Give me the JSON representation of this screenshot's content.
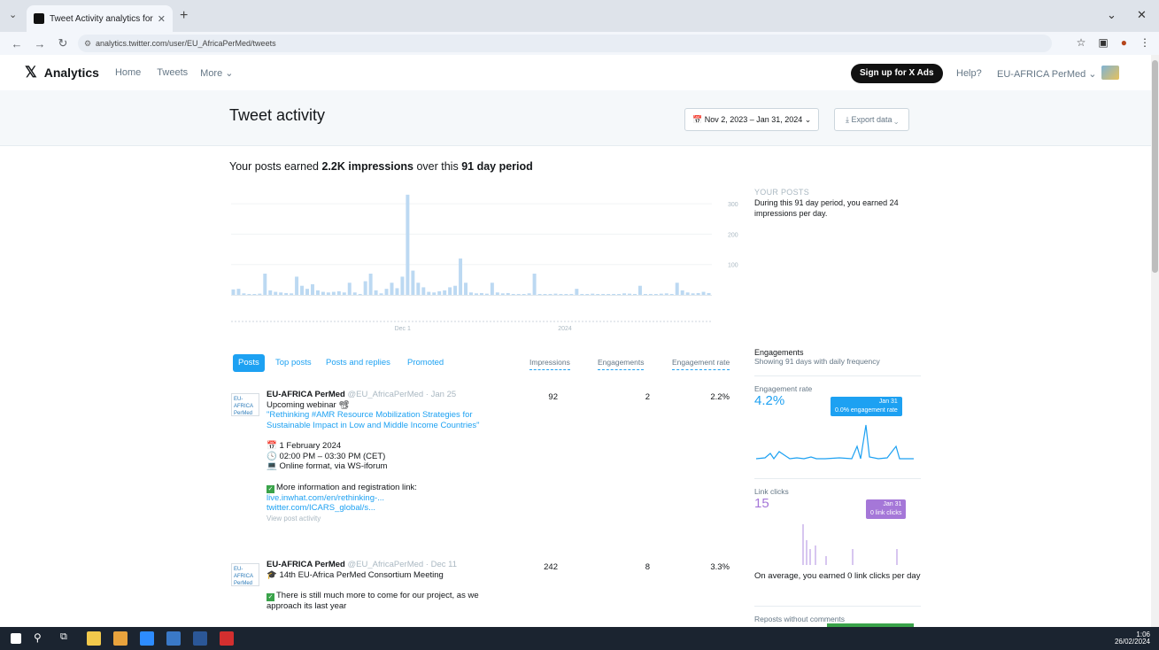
{
  "browser": {
    "tab_title": "Tweet Activity analytics for EU…",
    "url": "analytics.twitter.com/user/EU_AfricaPerMed/tweets"
  },
  "header": {
    "brand": "Analytics",
    "nav": [
      "Home",
      "Tweets",
      "More ⌄"
    ],
    "signup_label": "Sign up for X Ads",
    "help_label": "Help?",
    "account_label": "EU-AFRICA PerMed ⌄"
  },
  "title_band": {
    "title": "Tweet activity",
    "date_range": "📅 Nov 2, 2023 – Jan 31, 2024 ⌄",
    "export_label": "⤓ Export data ⌄"
  },
  "summary": {
    "prefix": "Your posts earned ",
    "highlight": "2.2K impressions",
    "middle": " over this ",
    "period": "91 day period"
  },
  "chart_data": {
    "type": "bar",
    "ylim": [
      0,
      350
    ],
    "yticks": [
      100,
      200,
      300
    ],
    "xtick_labels": [
      "Dec 1",
      "2024"
    ],
    "values": [
      18,
      20,
      5,
      3,
      2,
      4,
      70,
      15,
      10,
      8,
      6,
      5,
      60,
      30,
      20,
      35,
      15,
      10,
      8,
      10,
      12,
      8,
      40,
      8,
      3,
      45,
      70,
      15,
      5,
      20,
      40,
      22,
      60,
      330,
      80,
      40,
      25,
      10,
      8,
      12,
      15,
      25,
      30,
      120,
      40,
      8,
      5,
      6,
      4,
      40,
      8,
      5,
      6,
      3,
      3,
      2,
      5,
      70,
      2,
      2,
      3,
      4,
      2,
      2,
      3,
      20,
      3,
      2,
      4,
      2,
      3,
      2,
      3,
      2,
      5,
      4,
      3,
      30,
      2,
      3,
      2,
      4,
      5,
      3,
      40,
      15,
      8,
      5,
      6,
      10,
      6
    ],
    "highlight_marker": "—"
  },
  "your_posts": {
    "heading": "YOUR POSTS",
    "text": "During this 91 day period, you earned 24 impressions per day."
  },
  "post_tabs": [
    "Posts",
    "Top posts",
    "Posts and replies",
    "Promoted"
  ],
  "columns": [
    "Impressions",
    "Engagements",
    "Engagement rate"
  ],
  "posts": [
    {
      "avatar_text": "EU-AFRICA PerMed",
      "author": "EU-AFRICA PerMed",
      "handle": "@EU_AfricaPerMed · Jan 25",
      "lines": [
        "Upcoming webinar 📽",
        "\"Rethinking #AMR Resource Mobilization Strategies for",
        "Sustainable Impact in Low and Middle Income Countries\""
      ],
      "details": [
        "📅 1 February 2024",
        "🕓 02:00 PM – 03:30 PM (CET)",
        "💻 Online format, via WS-iforum"
      ],
      "info_line": "More information and registration link:",
      "links": [
        "live.inwhat.com/en/rethinking-...",
        "twitter.com/ICARS_global/s..."
      ],
      "activity_label": "View post activity",
      "impressions": "92",
      "engagements": "2",
      "rate": "2.2%"
    },
    {
      "avatar_text": "EU-AFRICA PerMed",
      "author": "EU-AFRICA PerMed",
      "handle": "@EU_AfricaPerMed · Dec 11",
      "lines": [
        "🎓 14th EU-Africa PerMed Consortium Meeting"
      ],
      "extra": [
        "There is still much more to come for our project, as we",
        "approach its last year"
      ],
      "impressions": "242",
      "engagements": "8",
      "rate": "3.3%"
    }
  ],
  "sidebar": {
    "engagements_title": "Engagements",
    "engagements_sub": "Showing 91 days with daily frequency",
    "rate_label": "Engagement rate",
    "rate_value": "4.2%",
    "rate_tip_date": "Jan 31",
    "rate_tip_value": "0.0% engagement rate",
    "clicks_label": "Link clicks",
    "clicks_value": "15",
    "clicks_tip_date": "Jan 31",
    "clicks_tip_value": "0 link clicks",
    "avg_text": "On average, you earned 0 link clicks per day",
    "reposts_label": "Reposts without comments"
  },
  "colors": {
    "accent": "#1da1f2",
    "bar": "#bcd9f2",
    "purple": "#a577d8"
  },
  "taskbar": {
    "time": "1:06",
    "date": "26/02/2024"
  }
}
